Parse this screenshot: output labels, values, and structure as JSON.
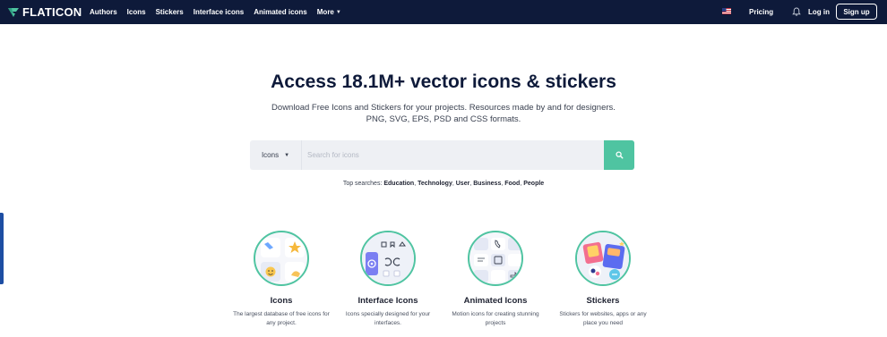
{
  "header": {
    "logo_text": "FLATICON",
    "nav": [
      "Authors",
      "Icons",
      "Stickers",
      "Interface icons",
      "Animated icons"
    ],
    "more_label": "More",
    "pricing": "Pricing",
    "login": "Log in",
    "signup": "Sign up"
  },
  "hero": {
    "title": "Access 18.1M+ vector icons & stickers",
    "subtitle_line1": "Download Free Icons and Stickers for your projects. Resources made by and for designers.",
    "subtitle_line2": "PNG, SVG, EPS, PSD and CSS formats."
  },
  "search": {
    "category": "Icons",
    "placeholder": "Search for icons",
    "button_color": "#4fc4a1"
  },
  "top_searches": {
    "label": "Top searches:",
    "items": [
      "Education",
      "Technology",
      "User",
      "Business",
      "Food",
      "People"
    ]
  },
  "categories": [
    {
      "title": "Icons",
      "desc": "The largest database of free icons for any project."
    },
    {
      "title": "Interface Icons",
      "desc": "Icons specially designed for your interfaces."
    },
    {
      "title": "Animated Icons",
      "desc": "Motion icons for creating stunning projects"
    },
    {
      "title": "Stickers",
      "desc": "Stickers for websites, apps or any place you need"
    }
  ],
  "colors": {
    "navbar": "#0e1a3a",
    "accent": "#4fc4a1",
    "side_tab": "#1d4ea3"
  }
}
